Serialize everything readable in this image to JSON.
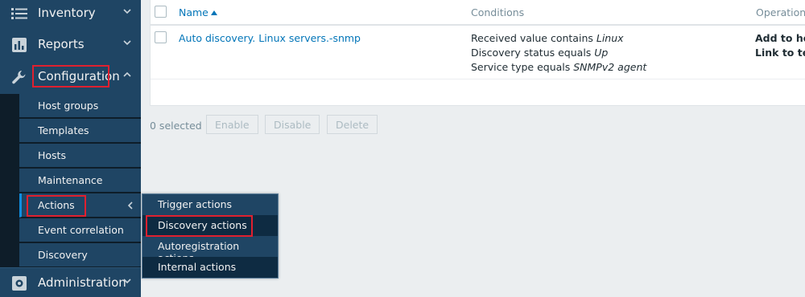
{
  "sidebar": {
    "inventory": {
      "label": "Inventory",
      "icon": "list-icon"
    },
    "reports": {
      "label": "Reports",
      "icon": "bar-chart-icon"
    },
    "configuration": {
      "label": "Configuration",
      "icon": "wrench-icon"
    },
    "administration": {
      "label": "Administration",
      "icon": "gear-icon"
    },
    "submenu": [
      {
        "label": "Host groups"
      },
      {
        "label": "Templates"
      },
      {
        "label": "Hosts"
      },
      {
        "label": "Maintenance"
      },
      {
        "label": "Actions"
      },
      {
        "label": "Event correlation"
      },
      {
        "label": "Discovery"
      }
    ]
  },
  "flyout": [
    {
      "label": "Trigger actions"
    },
    {
      "label": "Discovery actions"
    },
    {
      "label": "Autoregistration actions"
    },
    {
      "label": "Internal actions"
    }
  ],
  "table": {
    "headers": {
      "name": "Name",
      "conditions": "Conditions",
      "operations": "Operations"
    },
    "rows": [
      {
        "name": "Auto discovery. Linux servers.-snmp",
        "conditions": [
          {
            "text": "Received value contains ",
            "value": "Linux"
          },
          {
            "text": "Discovery status equals ",
            "value": "Up"
          },
          {
            "text": "Service type equals ",
            "value": "SNMPv2 agent"
          }
        ],
        "operations": [
          "Add to host",
          "Link to tem"
        ]
      }
    ]
  },
  "footer": {
    "selected": "0 selected",
    "enable": "Enable",
    "disable": "Disable",
    "delete": "Delete"
  },
  "colors": {
    "sidebar": "#1f4564",
    "submenu_dark": "#0e1d29",
    "link": "#0275b8",
    "highlight": "#e0202f"
  }
}
